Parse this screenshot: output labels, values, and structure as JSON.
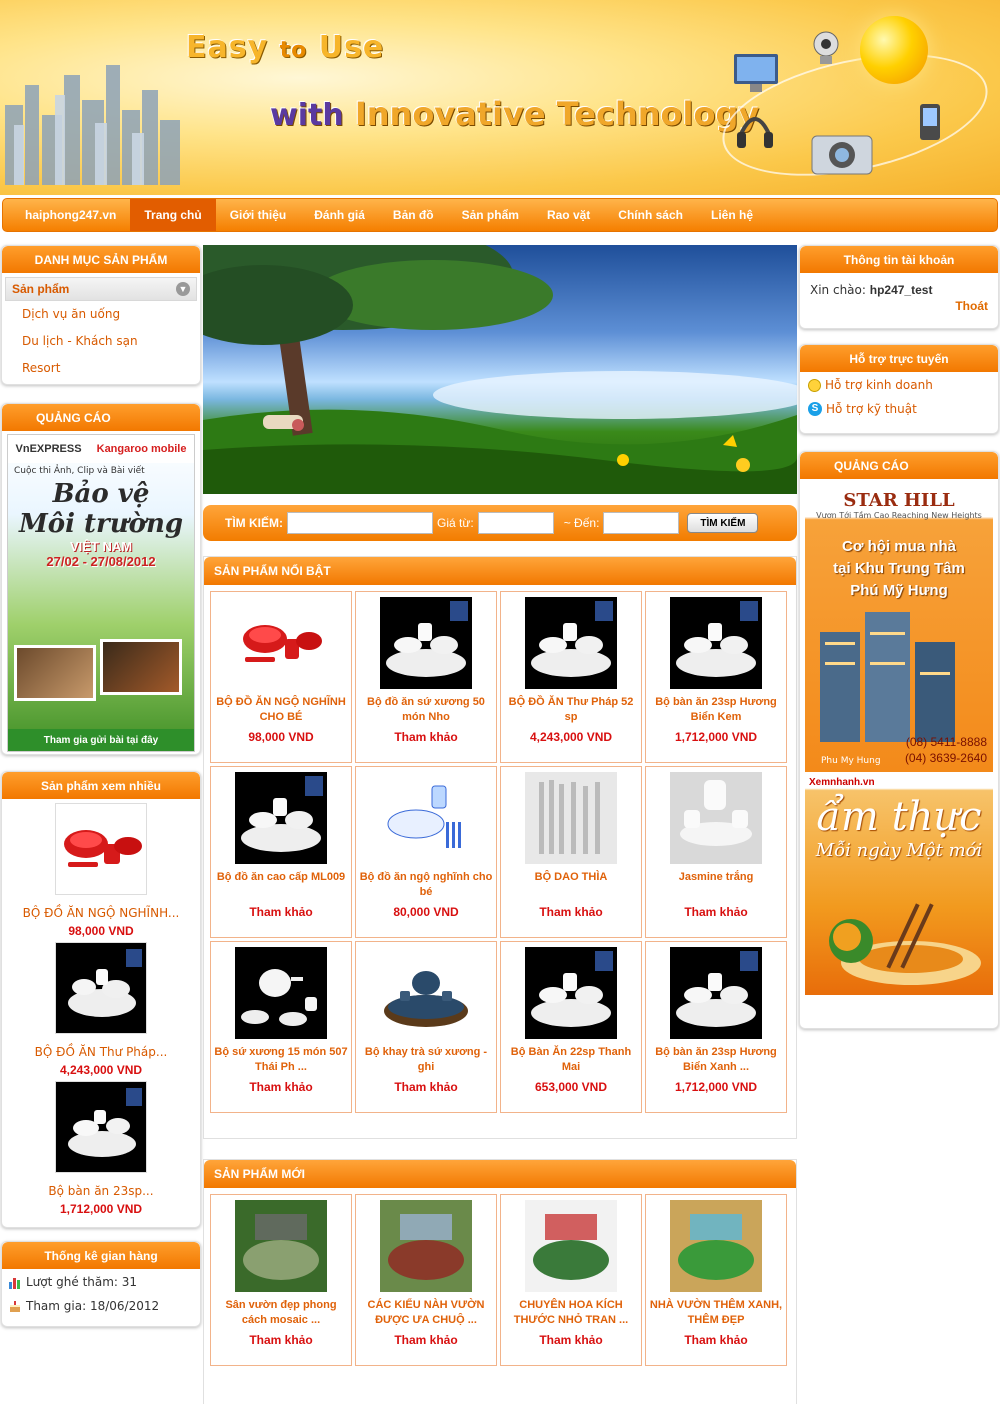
{
  "banner": {
    "slogan_easy": "Easy",
    "slogan_to": "to",
    "slogan_use": "Use",
    "slogan_with": "with",
    "slogan_tech": "Innovative Technology"
  },
  "nav": {
    "items": [
      "haiphong247.vn",
      "Trang chủ",
      "Giới thiệu",
      "Đánh giá",
      "Bản đồ",
      "Sản phẩm",
      "Rao vặt",
      "Chính sách",
      "Liên hệ"
    ],
    "active_index": 1
  },
  "left": {
    "category_title": "DANH MỤC SẢN PHẨM",
    "category_head": "Sản phẩm",
    "categories": [
      "Dịch vụ ăn uống",
      "Du lịch - Khách sạn",
      "Resort"
    ],
    "ads_title": "QUẢNG CÁO",
    "ad": {
      "logo1": "VnEXPRESS",
      "logo2": "Kangaroo mobile",
      "line1": "Cuộc thi Ảnh, Clip và Bài viết",
      "line2a": "Bảo vệ",
      "line2b": "Môi trường",
      "line3": "VIỆT NAM",
      "line4": "27/02 - 27/08/2012",
      "cta": "Tham gia gửi bài tại đây"
    },
    "viewed_title": "Sản phẩm xem nhiều",
    "viewed": [
      {
        "name": "BỘ ĐỒ ĂN NGỘ NGHĨNH...",
        "price": "98,000 VND"
      },
      {
        "name": "BỘ ĐỒ ĂN Thư Pháp...",
        "price": "4,243,000 VND"
      },
      {
        "name": "Bộ bàn ăn 23sp...",
        "price": "1,712,000 VND"
      }
    ],
    "stats_title": "Thống kê gian hàng",
    "visits": "Lượt ghé thăm: 31",
    "joined": "Tham gia: 18/06/2012"
  },
  "search": {
    "label": "TÌM KIẾM:",
    "price_from": "Giá từ:",
    "price_to": "~ Đến:",
    "button": "TÌM KIẾM"
  },
  "featured": {
    "title": "SẢN PHẨM NỔI BẬT",
    "items": [
      {
        "name": "BỘ ĐỒ ĂN NGỘ NGHĨNH CHO BÉ",
        "price": "98,000 VND",
        "img": "red-bowl-set"
      },
      {
        "name": "Bộ đồ ăn sứ xương 50 món Nho",
        "price": "Tham khảo",
        "img": "dinner-set"
      },
      {
        "name": "BỘ ĐỒ ĂN Thư Pháp 52 sp",
        "price": "4,243,000 VND",
        "img": "dinner-set"
      },
      {
        "name": "Bộ bàn ăn 23sp Hương Biển Kem",
        "price": "1,712,000 VND",
        "img": "dinner-set"
      },
      {
        "name": "Bộ đồ ăn cao cấp ML009",
        "price": "Tham khảo",
        "img": "dinner-set"
      },
      {
        "name": "Bộ đồ ăn ngộ nghĩnh cho bé",
        "price": "80,000 VND",
        "img": "kids-set"
      },
      {
        "name": "BỘ DAO THÌA",
        "price": "Tham khảo",
        "img": "cutlery"
      },
      {
        "name": "Jasmine trắng",
        "price": "Tham khảo",
        "img": "white-set"
      },
      {
        "name": "Bộ sứ xương 15 món 507 Thái Ph ...",
        "price": "Tham khảo",
        "img": "tea-set"
      },
      {
        "name": "Bộ khay trà sứ xương - ghi",
        "price": "Tham khảo",
        "img": "tea-tray"
      },
      {
        "name": "Bộ Bàn Ăn 22sp Thanh Mai",
        "price": "653,000 VND",
        "img": "dinner-set"
      },
      {
        "name": "Bộ bàn ăn 23sp Hương Biển Xanh ...",
        "price": "1,712,000 VND",
        "img": "dinner-set"
      }
    ]
  },
  "new_products": {
    "title": "SẢN PHẨM MỚI",
    "items": [
      {
        "name": "Sân vườn đẹp phong cách mosaic ...",
        "price": "Tham khảo"
      },
      {
        "name": "CÁC KIỂU NÀH VƯỜN ĐƯỢC ƯA CHUỘ ...",
        "price": "Tham khảo"
      },
      {
        "name": "CHUYÊN HOA KÍCH THƯỚC NHỎ TRAN ...",
        "price": "Tham khảo"
      },
      {
        "name": "NHÀ VƯỜN THÊM XANH, THÊM ĐẸP",
        "price": "Tham khảo"
      }
    ]
  },
  "right": {
    "account_title": "Thông tin tài khoản",
    "greeting": "Xin chào:",
    "username": "hp247_test",
    "logout": "Thoát",
    "support_title": "Hỗ trợ trực tuyến",
    "support_business": "Hỗ trợ kinh doanh",
    "support_tech": "Hỗ trợ kỹ thuật",
    "ads_title": "QUẢNG CÁO",
    "ad1": {
      "logo": "STAR HILL",
      "sub": "Vươn Tới Tầm Cao Reaching New Heights",
      "line1": "Cơ hội mua nhà",
      "line2": "tại Khu Trung Tâm",
      "line3": "Phú Mỹ Hưng",
      "brand": "Phu My Hung",
      "phone1": "(08) 5411-8888",
      "phone2": "(04) 3639-2640"
    },
    "ad2": {
      "site": "Xemnhanh.vn",
      "big": "ẩm thực",
      "small": "Mỗi ngày Một mới"
    }
  },
  "colors": {
    "accent": "#f27c00",
    "price": "#d81010",
    "link": "#d85a00"
  }
}
